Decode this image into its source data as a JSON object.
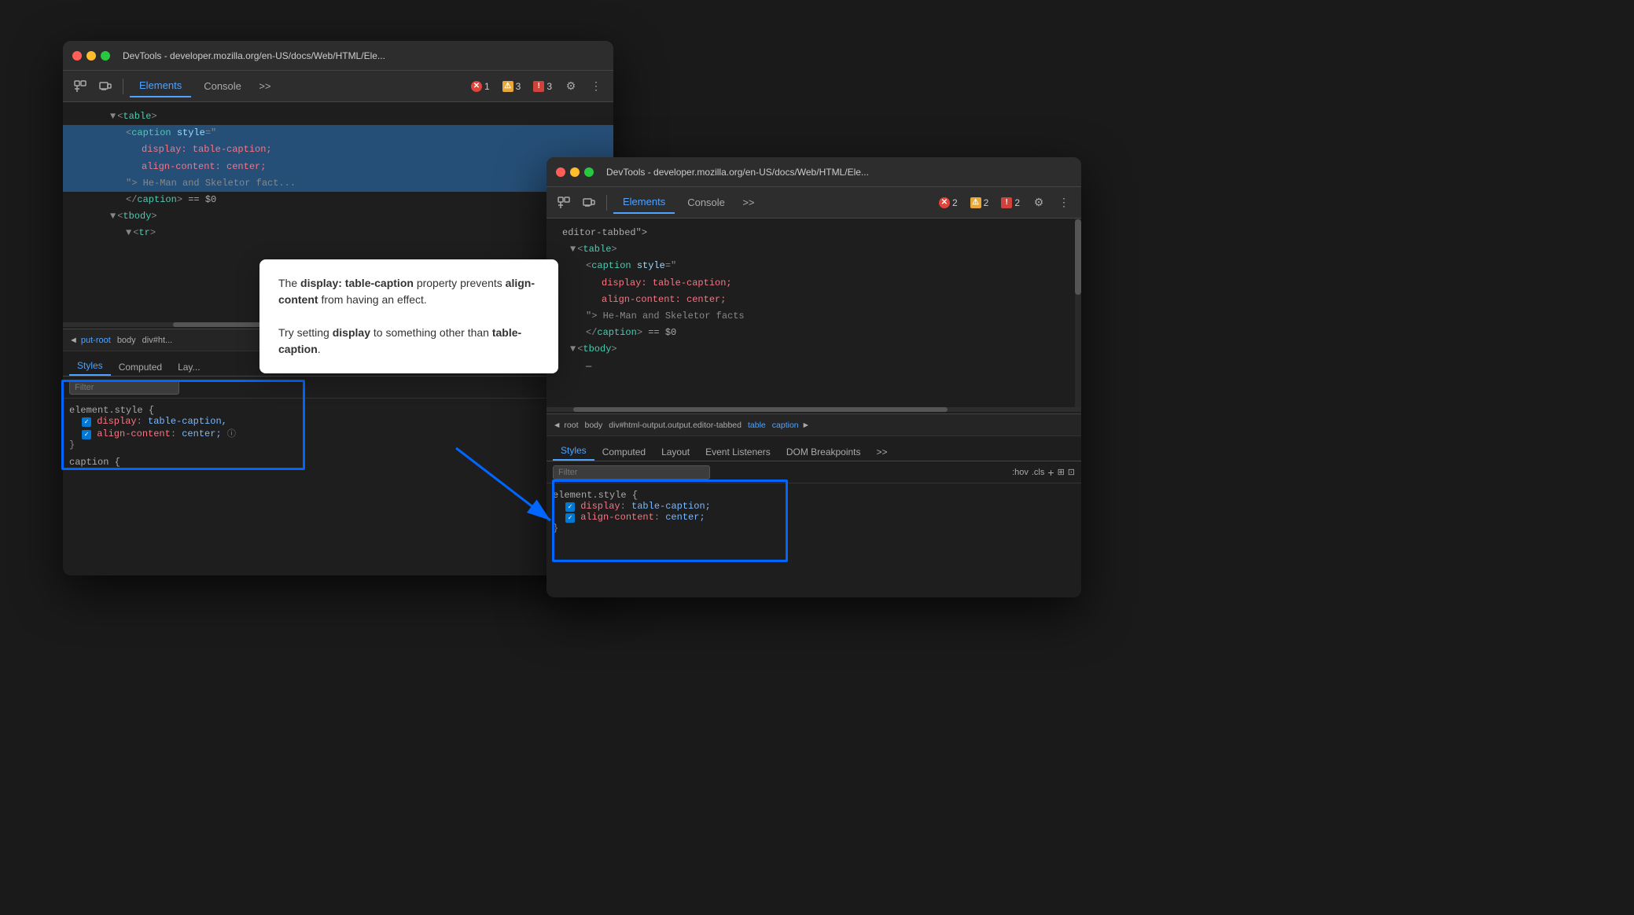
{
  "window1": {
    "title": "DevTools - developer.mozilla.org/en-US/docs/Web/HTML/Ele...",
    "tabs": [
      {
        "label": "Elements",
        "active": true
      },
      {
        "label": "Console",
        "active": false
      }
    ],
    "badges": [
      {
        "icon": "✕",
        "type": "error",
        "count": "1"
      },
      {
        "icon": "⚠",
        "type": "warn",
        "count": "3"
      },
      {
        "icon": "!",
        "type": "info",
        "count": "3"
      }
    ],
    "elements_code": [
      {
        "indent": 6,
        "text": "▼<table>",
        "selected": false
      },
      {
        "indent": 8,
        "text": "<caption style=\"",
        "selected": true
      },
      {
        "indent": 10,
        "text": "display: table-caption;",
        "selected": true
      },
      {
        "indent": 10,
        "text": "align-content: center;",
        "selected": true
      },
      {
        "indent": 8,
        "text": "\"> He-Man and Skeletor fact...",
        "selected": true
      },
      {
        "indent": 8,
        "text": "</caption> == $0",
        "selected": false
      },
      {
        "indent": 6,
        "text": "▼<tbody>",
        "selected": false
      },
      {
        "indent": 8,
        "text": "▼<tr>",
        "selected": false
      }
    ],
    "breadcrumb": [
      "◄",
      "put-root",
      "body",
      "div#ht..."
    ],
    "panel_tabs": [
      "Styles",
      "Computed",
      "Lay..."
    ],
    "filter_placeholder": "Filter",
    "style_rule": {
      "selector": "element.style {",
      "props": [
        {
          "name": "display",
          "value": "table-caption,"
        },
        {
          "name": "align-content",
          "value": "center;"
        }
      ],
      "close": "}"
    },
    "caption_selector": "caption {"
  },
  "window2": {
    "title": "DevTools - developer.mozilla.org/en-US/docs/Web/HTML/Ele...",
    "tabs": [
      {
        "label": "Elements",
        "active": true
      },
      {
        "label": "Console",
        "active": false
      }
    ],
    "badges": [
      {
        "icon": "✕",
        "type": "error",
        "count": "2"
      },
      {
        "icon": "⚠",
        "type": "warn",
        "count": "2"
      },
      {
        "icon": "!",
        "type": "info",
        "count": "2"
      }
    ],
    "elements_code": [
      {
        "indent": 0,
        "text": "editor-tabbed\">",
        "selected": false
      },
      {
        "indent": 2,
        "text": "▼<table>",
        "selected": false
      },
      {
        "indent": 4,
        "text": "<caption style=\"",
        "selected": false
      },
      {
        "indent": 6,
        "text": "display: table-caption;",
        "selected": false
      },
      {
        "indent": 6,
        "text": "align-content: center;",
        "selected": false
      },
      {
        "indent": 4,
        "text": "\"> He-Man and Skeletor facts",
        "selected": false
      },
      {
        "indent": 4,
        "text": "</caption> == $0",
        "selected": false
      },
      {
        "indent": 2,
        "text": "▼<tbody>",
        "selected": false
      },
      {
        "indent": 4,
        "text": "—",
        "selected": false
      }
    ],
    "breadcrumb": [
      "◄",
      "root",
      "body",
      "div#html-output.output.editor-tabbed",
      "table",
      "caption",
      "►"
    ],
    "panel_tabs": [
      "Styles",
      "Computed",
      "Layout",
      "Event Listeners",
      "DOM Breakpoints",
      ">>"
    ],
    "filter_placeholder": "Filter",
    "filter_suffix_buttons": [
      ":hov",
      ".cls",
      "+",
      "⊞",
      "⊡"
    ],
    "style_rule": {
      "selector": "element.style {",
      "props": [
        {
          "name": "display",
          "value": "table-caption;"
        },
        {
          "name": "align-content",
          "value": "center;"
        }
      ],
      "close": "}"
    }
  },
  "callout": {
    "line1_before": "The ",
    "line1_bold1": "display: table-caption",
    "line1_after": " property",
    "line2_before": "prevents ",
    "line2_bold2": "align-content",
    "line2_after": " from having an",
    "line3": "effect.",
    "line4_before": "Try setting ",
    "line4_bold": "display",
    "line4_after": " to something other than",
    "line5_bold": "table-caption",
    "line5_after": "."
  },
  "highlight_box1": {
    "label": "highlight-box-window1"
  },
  "highlight_box2": {
    "label": "highlight-box-window2"
  }
}
